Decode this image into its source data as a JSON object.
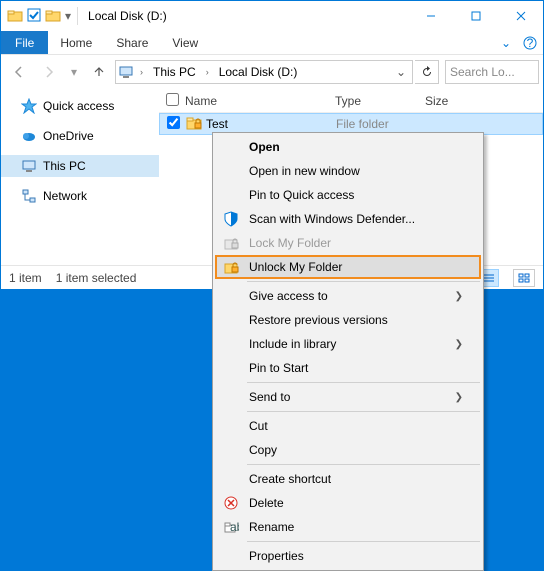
{
  "titlebar": {
    "title": "Local Disk (D:)"
  },
  "ribbon": {
    "file": "File",
    "tabs": [
      "Home",
      "Share",
      "View"
    ]
  },
  "breadcrumb": {
    "root": "This PC",
    "path": "Local Disk (D:)"
  },
  "search": {
    "placeholder": "Search Lo..."
  },
  "nav": {
    "items": [
      {
        "label": "Quick access",
        "icon": "star"
      },
      {
        "label": "OneDrive",
        "icon": "cloud"
      },
      {
        "label": "This PC",
        "icon": "pc",
        "selected": true
      },
      {
        "label": "Network",
        "icon": "net"
      }
    ]
  },
  "columns": {
    "name": "Name",
    "type": "Type",
    "size": "Size"
  },
  "rows": [
    {
      "name": "Test",
      "type": "File folder",
      "checked": true
    }
  ],
  "status": {
    "count": "1 item",
    "selected": "1 item selected"
  },
  "context": {
    "groups": [
      [
        {
          "label": "Open",
          "bold": true
        },
        {
          "label": "Open in new window"
        },
        {
          "label": "Pin to Quick access"
        },
        {
          "label": "Scan with Windows Defender...",
          "icon": "shield"
        },
        {
          "label": "Lock My Folder",
          "icon": "lock",
          "disabled": true
        },
        {
          "label": "Unlock My Folder",
          "icon": "unlock",
          "highlight": true
        }
      ],
      [
        {
          "label": "Give access to",
          "submenu": true
        },
        {
          "label": "Restore previous versions"
        },
        {
          "label": "Include in library",
          "submenu": true
        },
        {
          "label": "Pin to Start"
        }
      ],
      [
        {
          "label": "Send to",
          "submenu": true
        }
      ],
      [
        {
          "label": "Cut"
        },
        {
          "label": "Copy"
        }
      ],
      [
        {
          "label": "Create shortcut"
        },
        {
          "label": "Delete",
          "icon": "delete"
        },
        {
          "label": "Rename",
          "icon": "rename"
        }
      ],
      [
        {
          "label": "Properties"
        }
      ]
    ]
  }
}
